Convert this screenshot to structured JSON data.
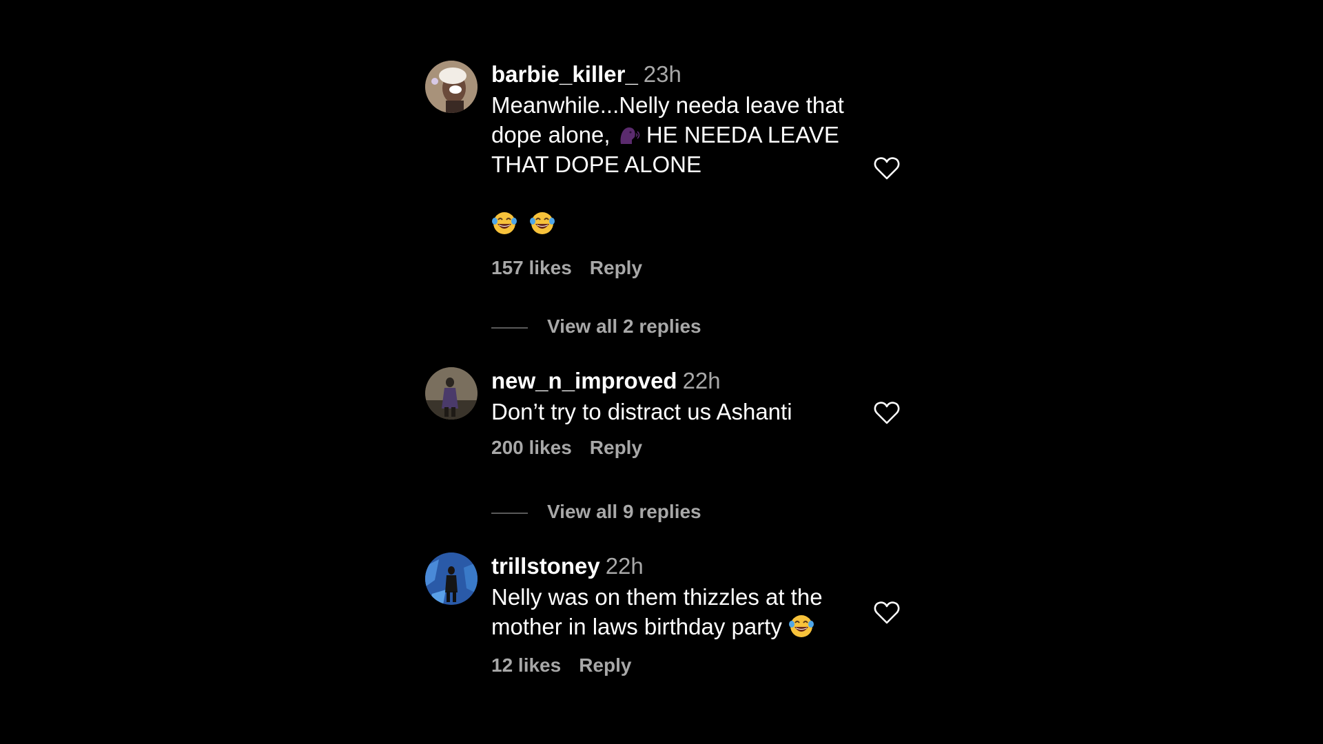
{
  "comments": [
    {
      "username": "barbie_killer_",
      "time": "23h",
      "text_line1": "Meanwhile...Nelly needa leave that",
      "text_line2a": "dope alone,",
      "text_line2b": "HE NEEDA LEAVE",
      "text_line3": "THAT DOPE ALONE",
      "emoji_line_icons": [
        "laughing-crying-emoji",
        "laughing-crying-emoji"
      ],
      "inline_icon": "speaking-head-emoji",
      "likes": "157 likes",
      "reply_label": "Reply",
      "view_replies": "View all 2 replies"
    },
    {
      "username": "new_n_improved",
      "time": "22h",
      "text_line1": "Don’t try to distract us Ashanti",
      "likes": "200 likes",
      "reply_label": "Reply",
      "view_replies": "View all 9 replies"
    },
    {
      "username": "trillstoney",
      "time": "22h",
      "text_line1": "Nelly was on them thizzles at the",
      "text_line2": "mother in laws birthday party",
      "inline_icon": "laughing-crying-emoji",
      "likes": "12 likes",
      "reply_label": "Reply"
    }
  ],
  "colors": {
    "background": "#000000",
    "primary_text": "#ffffff",
    "secondary_text": "#a8a8a8",
    "divider": "#5a5a5a"
  }
}
